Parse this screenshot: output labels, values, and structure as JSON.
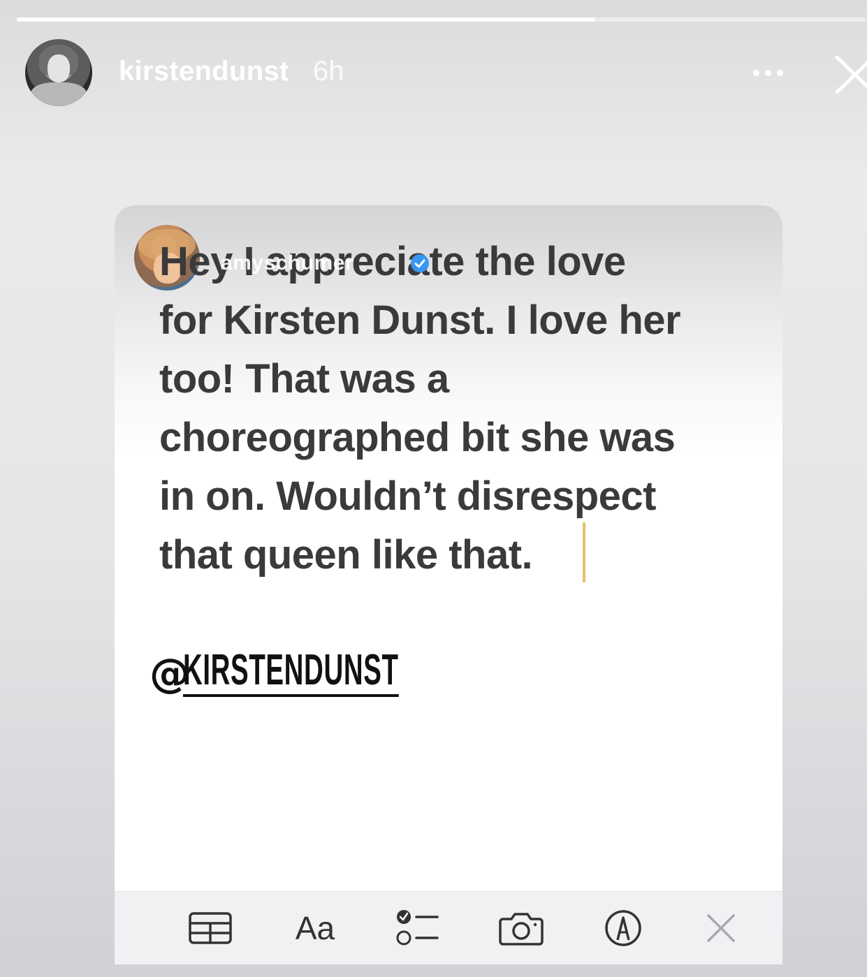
{
  "story": {
    "progress": 0.68,
    "user": {
      "username": "kirstendunst",
      "time_ago": "6h",
      "avatar_icon": "profile-photo"
    },
    "more_icon": "ellipsis-icon",
    "close_icon": "close-x-icon"
  },
  "note": {
    "reshared_from": "amyschumer",
    "verified": true,
    "lines": [
      "Hey I appreciate the love",
      "for Kirsten Dunst. I love her",
      "too! That was a",
      "choreographed bit she was",
      "in on. Wouldn’t disrespect",
      "that queen like that."
    ],
    "mention": {
      "at": "@",
      "name": "KIRSTENDUNST"
    }
  },
  "toolbar": {
    "items": [
      "table-icon",
      "Aa",
      "checklist-icon",
      "camera-icon",
      "markup-pen-icon",
      "close-icon"
    ]
  },
  "colors": {
    "text": "#3a3a3c",
    "cursor": "#e3c26b",
    "verified": "#3897f0",
    "toolbar": "#f1f1f3"
  }
}
